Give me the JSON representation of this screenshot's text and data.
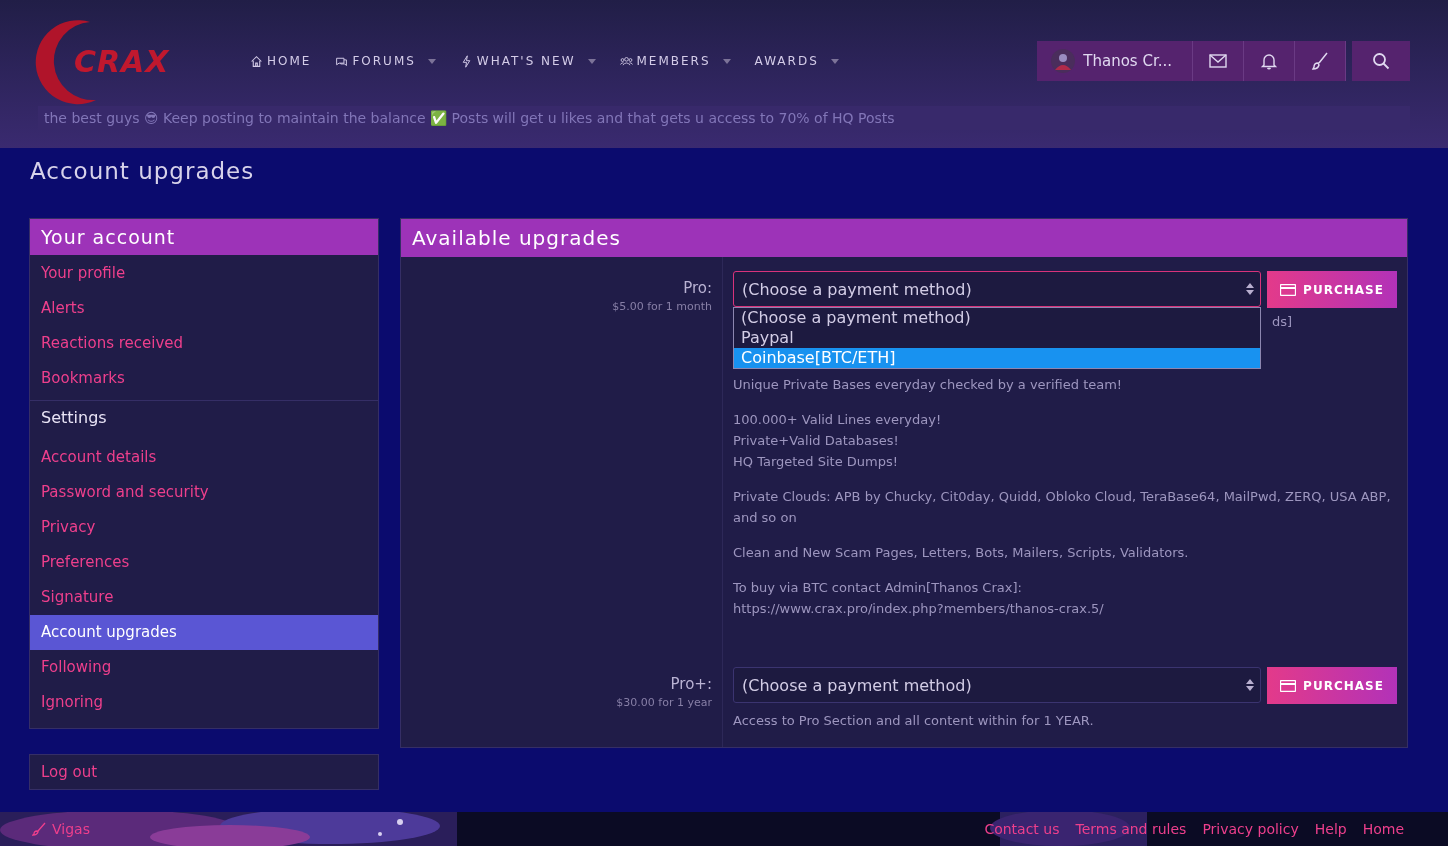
{
  "header": {
    "logo": "CRAX",
    "nav": [
      {
        "label": "HOME",
        "kind": "home",
        "dropdown": false
      },
      {
        "label": "FORUMS",
        "kind": "chat",
        "dropdown": true
      },
      {
        "label": "WHAT'S NEW",
        "kind": "bolt",
        "dropdown": true
      },
      {
        "label": "MEMBERS",
        "kind": "users",
        "dropdown": true
      },
      {
        "label": "AWARDS",
        "kind": "plain",
        "dropdown": true
      }
    ],
    "user": "Thanos Cr...",
    "notice": "the best guys 😎 Keep posting to maintain the balance ✅ Posts will get u likes and that gets u access to 70% of HQ Posts"
  },
  "page_title": "Account upgrades",
  "sidebar": {
    "sections": [
      {
        "title": "Your account",
        "kind": "header",
        "items": [
          {
            "label": "Your profile",
            "selected": false
          },
          {
            "label": "Alerts",
            "selected": false
          },
          {
            "label": "Reactions received",
            "selected": false
          },
          {
            "label": "Bookmarks",
            "selected": false
          }
        ]
      },
      {
        "title": "Settings",
        "kind": "plain",
        "items": [
          {
            "label": "Account details",
            "selected": false
          },
          {
            "label": "Password and security",
            "selected": false
          },
          {
            "label": "Privacy",
            "selected": false
          },
          {
            "label": "Preferences",
            "selected": false
          },
          {
            "label": "Signature",
            "selected": false
          },
          {
            "label": "Account upgrades",
            "selected": true
          },
          {
            "label": "Following",
            "selected": false
          },
          {
            "label": "Ignoring",
            "selected": false
          }
        ]
      }
    ],
    "logout": "Log out"
  },
  "upgrades": {
    "title": "Available upgrades",
    "items": [
      {
        "name": "Pro:",
        "cost": "$5.00 for 1 month",
        "select": "(Choose a payment method)",
        "button": "PURCHASE",
        "expanded": true,
        "options": [
          {
            "label": "(Choose a payment method)",
            "selected": false
          },
          {
            "label": "Paypal",
            "selected": false
          },
          {
            "label": "Coinbase[BTC/ETH]",
            "selected": true
          }
        ],
        "hidden_fragment": "ds]",
        "paragraphs": [
          [
            "Unique Private Bases everyday checked by a verified team!"
          ],
          [
            "100.000+ Valid Lines everyday!",
            "Private+Valid Databases!",
            "HQ Targeted Site Dumps!"
          ],
          [
            "Private Clouds: APB by Chucky, Cit0day, Quidd, Obloko Cloud, TeraBase64, MailPwd, ZERQ, USA ABP, and so on"
          ],
          [
            "Clean and New Scam Pages, Letters, Bots, Mailers, Scripts, Validators."
          ],
          [
            "To buy via BTC contact Admin[Thanos Crax]:",
            "https://www.crax.pro/index.php?members/thanos-crax.5/"
          ]
        ]
      },
      {
        "name": "Pro+:",
        "cost": "$30.00 for 1 year",
        "select": "(Choose a payment method)",
        "button": "PURCHASE",
        "expanded": false,
        "paragraphs": [
          [
            "Access to Pro Section and all content within for 1 YEAR."
          ]
        ]
      }
    ]
  },
  "footer": {
    "user": "Vigas",
    "links": [
      "Contact us",
      "Terms and rules",
      "Privacy policy",
      "Help",
      "Home"
    ]
  }
}
